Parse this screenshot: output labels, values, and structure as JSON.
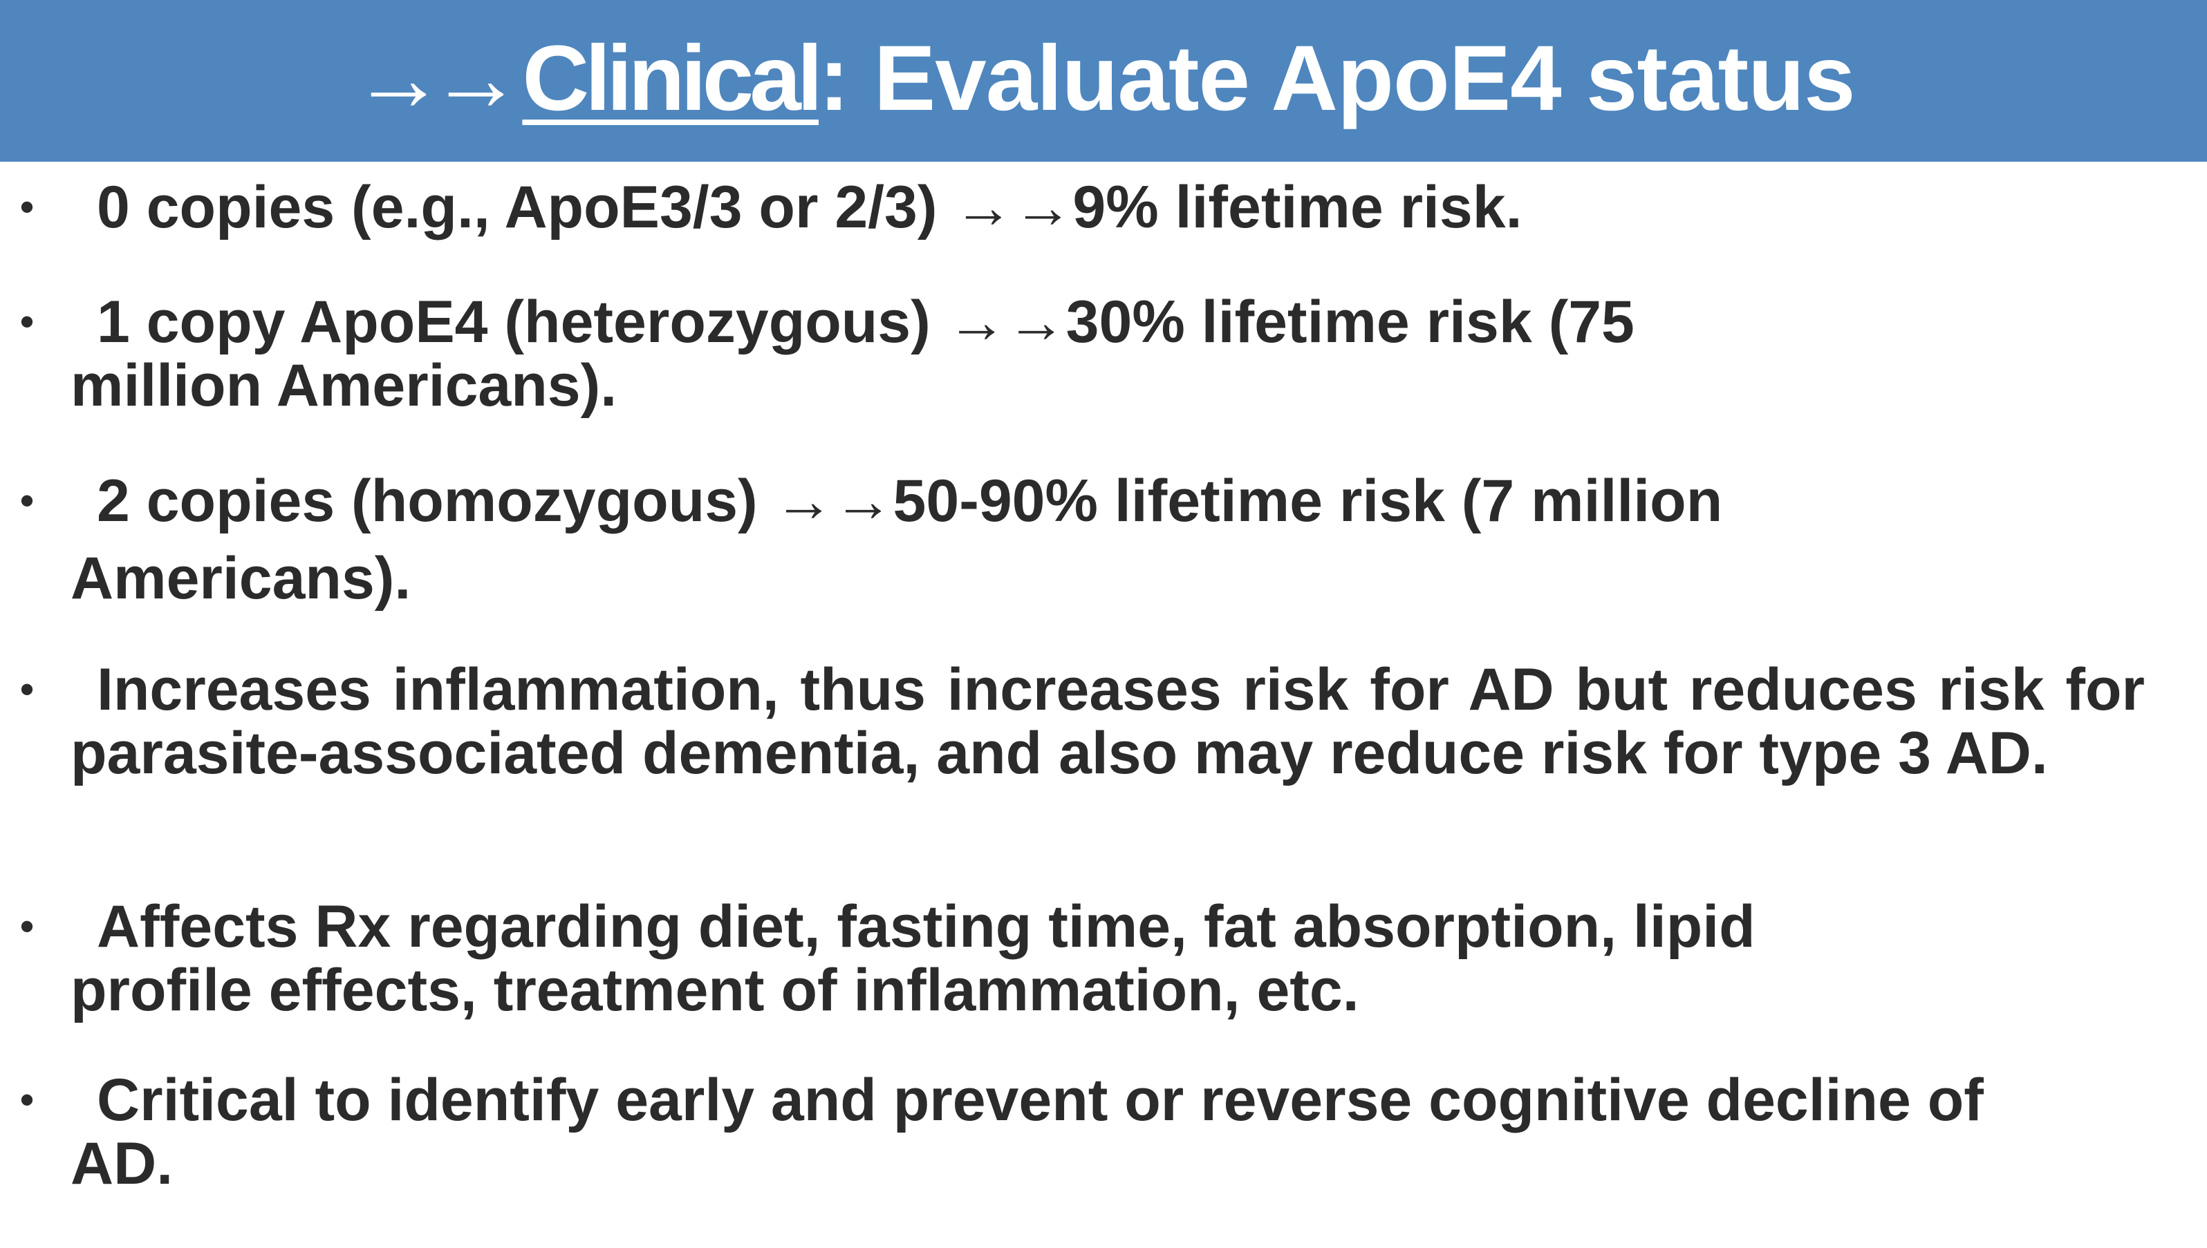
{
  "slide": {
    "title": {
      "arrows": "→→",
      "emphasis": "Clinical",
      "rest": ": Evaluate ApoE4 status"
    },
    "bullet_marker": "•",
    "bullets": [
      "0 copies (e.g., ApoE3/3 or 2/3) →→9% lifetime risk.",
      "1 copy ApoE4 (heterozygous) →→30% lifetime risk (75 million Americans).",
      "2 copies (homozygous) →→50-90% lifetime risk (7 million Americans).",
      "Increases inflammation, thus increases risk for AD but reduces risk for parasite-associated dementia, and also may reduce risk for type 3 AD.",
      "Affects Rx regarding diet, fasting time, fat absorption, lipid profile effects, treatment of inflammation, etc.",
      "Critical to identify early and prevent or reverse cognitive decline of AD."
    ]
  }
}
